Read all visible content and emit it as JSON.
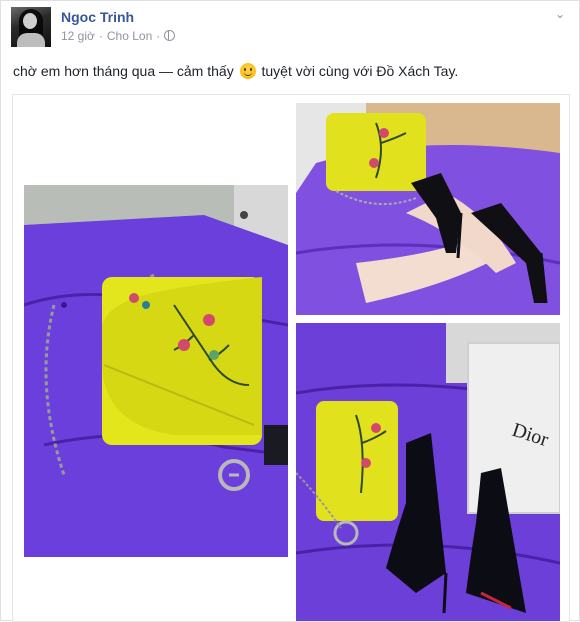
{
  "post": {
    "author": "Ngoc Trinh",
    "time": "12 giờ",
    "location": "Cho Lon",
    "caption_before": "chờ em hơn tháng qua — cảm thấy",
    "caption_after": "tuyệt vời cùng với Đồ Xách Tay.",
    "photos": [
      {
        "alt": "yellow clutch with jeweled flowers on purple ottoman"
      },
      {
        "alt": "yellow bag and black patent heels worn on purple ottoman"
      },
      {
        "alt": "yellow bag, black heels and Dior box on purple ottoman",
        "brand": "Dior"
      }
    ]
  },
  "colors": {
    "link": "#365899",
    "meta": "#90949c",
    "purple": "#6a3fd6",
    "yellow": "#e4e61c"
  }
}
